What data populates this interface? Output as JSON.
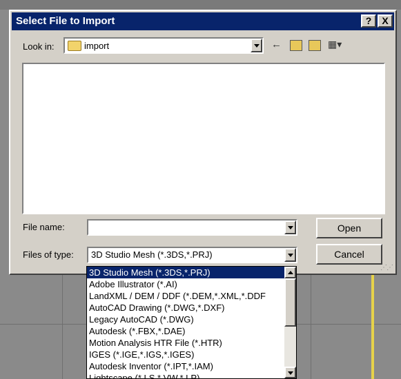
{
  "window": {
    "title": "Select File to Import",
    "help_label": "?",
    "close_label": "X"
  },
  "look_in": {
    "label": "Look in:",
    "folder": "import"
  },
  "toolbar": {
    "back_icon": "←",
    "up_icon": "⬑",
    "new_folder_icon": "✱",
    "view_icon": "▦▾"
  },
  "file_name": {
    "label": "File name:",
    "value": ""
  },
  "files_of_type": {
    "label": "Files of type:",
    "value": "3D Studio Mesh (*.3DS,*.PRJ)",
    "options": [
      "3D Studio Mesh (*.3DS,*.PRJ)",
      "Adobe Illustrator (*.AI)",
      "LandXML / DEM / DDF (*.DEM,*.XML,*.DDF",
      "AutoCAD Drawing (*.DWG,*.DXF)",
      "Legacy AutoCAD (*.DWG)",
      "Autodesk (*.FBX,*.DAE)",
      "Motion Analysis HTR File (*.HTR)",
      "IGES (*.IGE,*.IGS,*.IGES)",
      "Autodesk Inventor (*.IPT,*.IAM)",
      "Lightscape (*.LS,*.VW,*.LP)"
    ]
  },
  "buttons": {
    "open": "Open",
    "cancel": "Cancel"
  }
}
